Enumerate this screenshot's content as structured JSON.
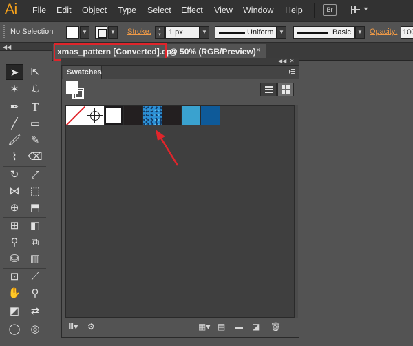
{
  "app": {
    "logo": "Ai"
  },
  "menu": [
    "File",
    "Edit",
    "Object",
    "Type",
    "Select",
    "Effect",
    "View",
    "Window",
    "Help"
  ],
  "top_buttons": {
    "bridge": "Br"
  },
  "control_bar": {
    "selection": "No Selection",
    "stroke_label": "Stroke:",
    "stroke_weight": "1 px",
    "stroke_profile": "Uniform",
    "brush": "Basic",
    "opacity_label": "Opacity:",
    "opacity_value": "100"
  },
  "document": {
    "name": "xmas_pattern [Converted].eps",
    "view": "@ 50% (RGB/Preview)",
    "close": "×"
  },
  "swatches_panel": {
    "tab": "Swatches",
    "swatches": [
      {
        "name": "[None]"
      },
      {
        "name": "[Registration]"
      },
      {
        "name": "White",
        "color": "#ffffff"
      },
      {
        "name": "Black",
        "color": "#231f20"
      },
      {
        "name": "Pattern",
        "color": "#2b8fd4"
      },
      {
        "name": "Black",
        "color": "#231f20"
      },
      {
        "name": "Light Blue",
        "color": "#3aa2cf"
      },
      {
        "name": "Dark Blue",
        "color": "#0e5a99"
      }
    ]
  },
  "colors": {
    "annotation_red": "#e0252b",
    "accent_orange": "#f09a46",
    "logo_orange": "#f7a21b"
  }
}
